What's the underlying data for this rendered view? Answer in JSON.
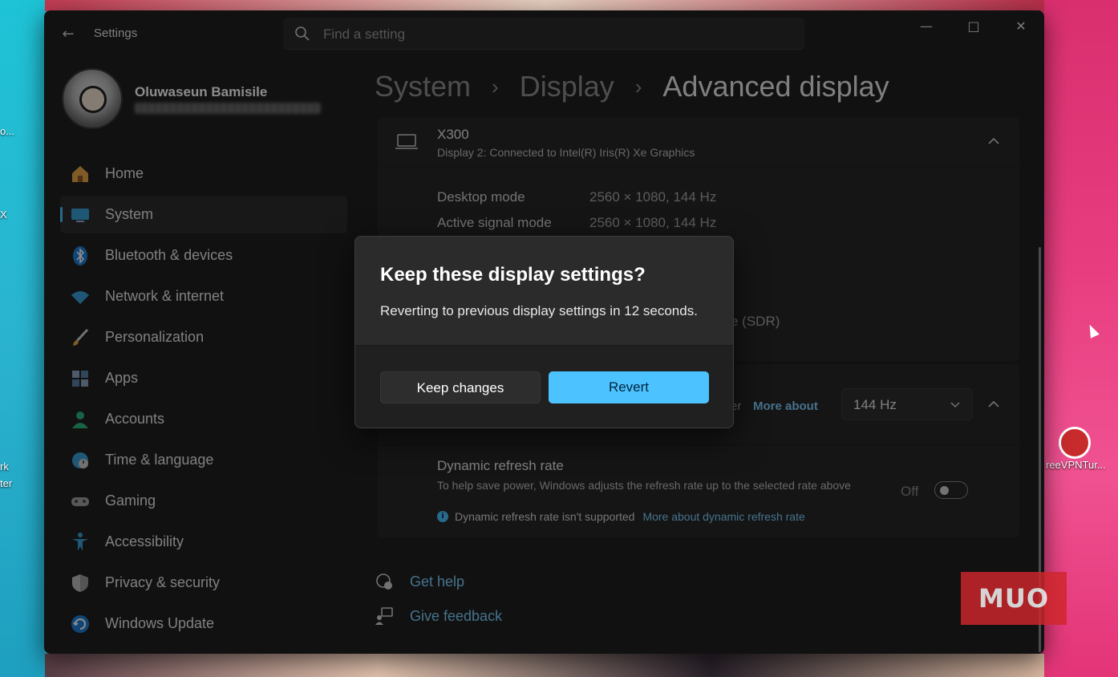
{
  "window": {
    "app_title": "Settings",
    "search_placeholder": "Find a setting"
  },
  "profile": {
    "name": "Oluwaseun Bamisile"
  },
  "nav": {
    "items": [
      {
        "label": "Home",
        "icon": "home-icon",
        "active": false
      },
      {
        "label": "System",
        "icon": "system-icon",
        "active": true
      },
      {
        "label": "Bluetooth & devices",
        "icon": "bluetooth-icon",
        "active": false
      },
      {
        "label": "Network & internet",
        "icon": "wifi-icon",
        "active": false
      },
      {
        "label": "Personalization",
        "icon": "brush-icon",
        "active": false
      },
      {
        "label": "Apps",
        "icon": "apps-icon",
        "active": false
      },
      {
        "label": "Accounts",
        "icon": "person-icon",
        "active": false
      },
      {
        "label": "Time & language",
        "icon": "clock-globe-icon",
        "active": false
      },
      {
        "label": "Gaming",
        "icon": "gamepad-icon",
        "active": false
      },
      {
        "label": "Accessibility",
        "icon": "accessibility-icon",
        "active": false
      },
      {
        "label": "Privacy & security",
        "icon": "shield-icon",
        "active": false
      },
      {
        "label": "Windows Update",
        "icon": "update-icon",
        "active": false
      }
    ]
  },
  "breadcrumb": {
    "items": [
      "System",
      "Display",
      "Advanced display"
    ],
    "separator": "›"
  },
  "display_card": {
    "title": "X300",
    "subtitle": "Display 2: Connected to Intel(R) Iris(R) Xe Graphics",
    "rows": [
      {
        "label": "Desktop mode",
        "value": "2560 × 1080, 144 Hz"
      },
      {
        "label": "Active signal mode",
        "value": "2560 × 1080, 144 Hz"
      }
    ],
    "partial_value": "e (SDR)"
  },
  "refresh_card": {
    "cut_text": "er",
    "more_about": "More about",
    "rate_value": "144 Hz",
    "drr_title": "Dynamic refresh rate",
    "drr_desc": "To help save power, Windows adjusts the refresh rate up to the selected rate above",
    "drr_note": "Dynamic refresh rate isn't supported",
    "drr_link": "More about dynamic refresh rate",
    "toggle_label": "Off",
    "toggle_on": false
  },
  "footer": {
    "get_help": "Get help",
    "give_feedback": "Give feedback"
  },
  "dialog": {
    "title": "Keep these display settings?",
    "body": "Reverting to previous display settings in 12 seconds.",
    "keep_label": "Keep changes",
    "revert_label": "Revert"
  },
  "desktop": {
    "labels_left": [
      "o...",
      "X",
      "rk",
      "ter"
    ],
    "icon_label": "reeVPNTur..."
  },
  "watermark": {
    "text": "MUO"
  },
  "colors": {
    "accent": "#4cc2ff",
    "window_bg": "#202020",
    "card_bg": "#272727",
    "watermark": "#d0262b"
  }
}
